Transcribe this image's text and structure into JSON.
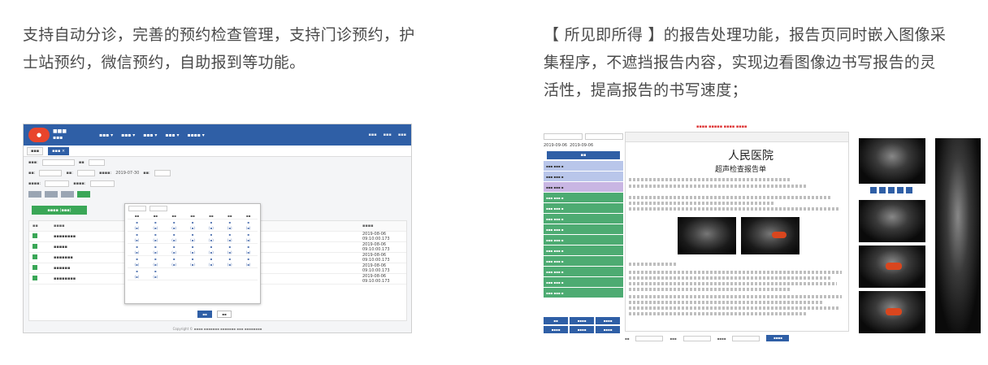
{
  "descriptions": {
    "left": [
      "支持自动分诊，完善的预约检查管理，支持门诊预约，护",
      "士站预约，微信预约，自助报到等功能。"
    ],
    "right": [
      "【 所见即所得 】的报告处理功能，报告页同时嵌入图像采",
      "集程序，不遮挡报告内容，实现边看图像边书写报告的灵",
      "活性，提高报告的书写速度；"
    ]
  },
  "left_screenshot": {
    "dates": {
      "year_2019": "2019-07-30"
    },
    "table_times": [
      "2019-08-06 09:10:00.173",
      "2019-08-06 09:10:00.173",
      "2019-08-06 09:10:00.173",
      "2019-08-06 09:10:00.173",
      "2019-08-06 09:10:00.173"
    ],
    "colors": {
      "topbar": "#2f5fa6",
      "green": "#3aa757"
    },
    "icons": [
      "logo-icon",
      "checkbox-icon"
    ]
  },
  "right_screenshot": {
    "date_from": "2019-09-06",
    "date_to": "2019-09-06",
    "hospital_name": "人民医院",
    "report_title": "超声检查报告单",
    "colors": {
      "accent": "#2f5fa6",
      "doppler": "#d9461e"
    },
    "icons": [
      "ultrasound-image",
      "zoom-icon"
    ]
  }
}
